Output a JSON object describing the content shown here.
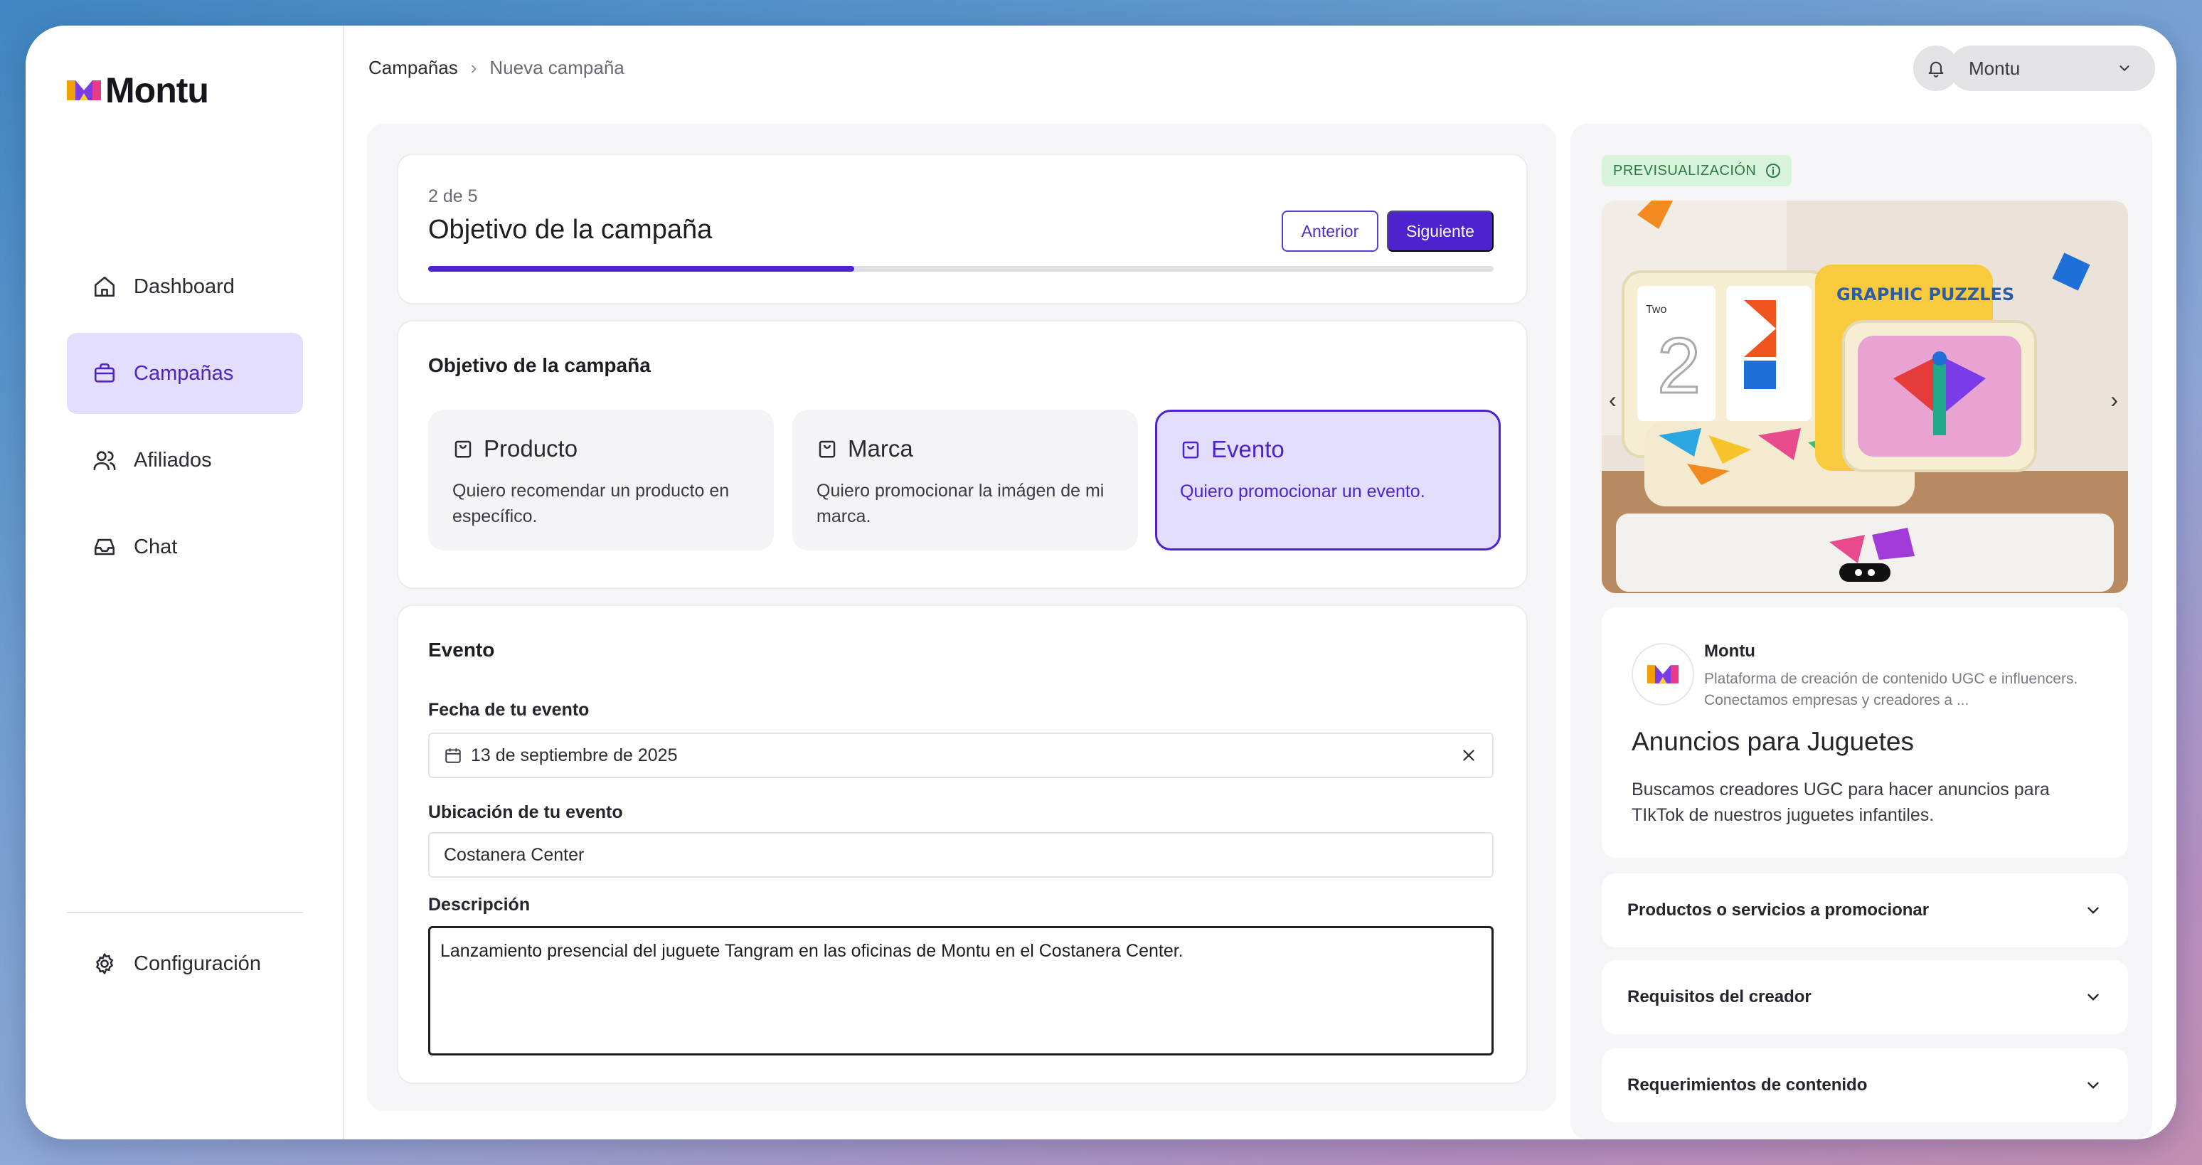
{
  "app": {
    "logo_text": "Montu",
    "brand_colors": {
      "accent": "#4d22cf",
      "accent_light": "#e3defd"
    }
  },
  "sidebar": {
    "items": [
      {
        "label": "Dashboard",
        "icon": "home-icon",
        "active": false
      },
      {
        "label": "Campañas",
        "icon": "briefcase-icon",
        "active": true
      },
      {
        "label": "Afiliados",
        "icon": "users-icon",
        "active": false
      },
      {
        "label": "Chat",
        "icon": "inbox-icon",
        "active": false
      }
    ],
    "config_label": "Configuración"
  },
  "topbar": {
    "breadcrumb": [
      "Campañas",
      "Nueva campaña"
    ],
    "account_label": "Montu"
  },
  "step": {
    "count": "2 de 5",
    "title": "Objetivo de la campaña",
    "prev_label": "Anterior",
    "next_label": "Siguiente",
    "progress": 0.4
  },
  "objective": {
    "title": "Objetivo de la campaña",
    "options": [
      {
        "label": "Producto",
        "desc": "Quiero recomendar un producto en específico.",
        "selected": false
      },
      {
        "label": "Marca",
        "desc": "Quiero promocionar la imágen de mi marca.",
        "selected": false
      },
      {
        "label": "Evento",
        "desc": "Quiero promocionar un evento.",
        "selected": true
      }
    ]
  },
  "event": {
    "title": "Evento",
    "date_label": "Fecha de tu evento",
    "date_value": "13 de septiembre de 2025",
    "location_label": "Ubicación de tu evento",
    "location_value": "Costanera Center",
    "description_label": "Descripción",
    "description_value": "Lanzamiento presencial del juguete Tangram en las oficinas de Montu en el Costanera Center."
  },
  "preview": {
    "badge": "PREVISUALIZACIÓN",
    "image_text": "GRAPHIC PUZZLES",
    "image_text_two": "Two",
    "brand_name": "Montu",
    "brand_desc": "Plataforma de creación de contenido UGC e influencers. Conectamos empresas y creadores a ...",
    "campaign_title": "Anuncios para Juguetes",
    "campaign_desc": "Buscamos creadores UGC para hacer anuncios para TIkTok de nuestros juguetes infantiles.",
    "accordions": [
      "Productos o servicios a promocionar",
      "Requisitos del creador",
      "Requerimientos de contenido"
    ]
  }
}
